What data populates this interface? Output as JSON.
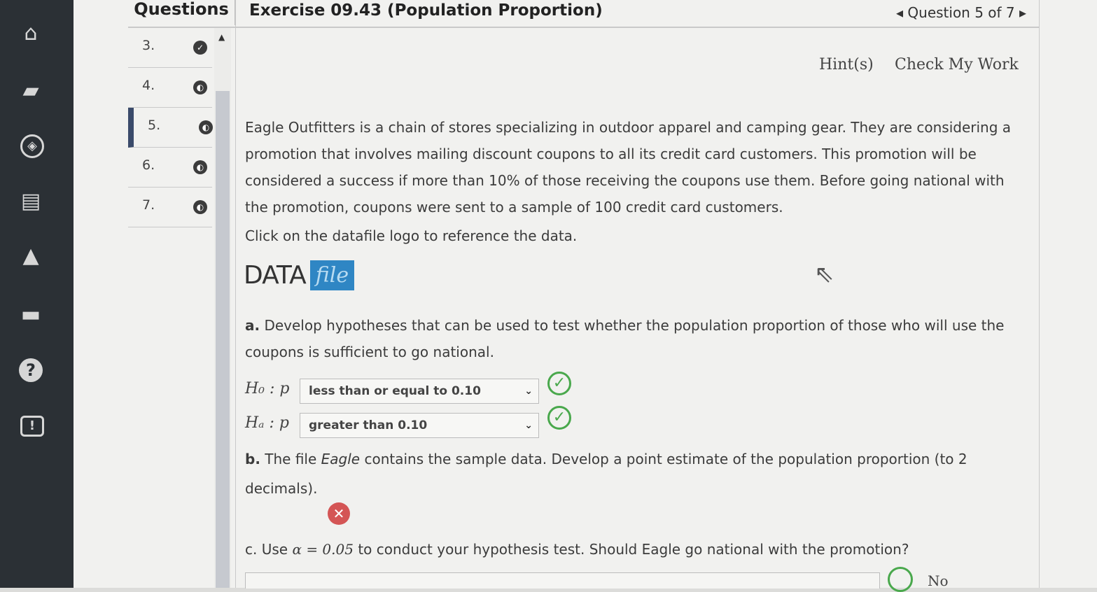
{
  "rail": {
    "icons": [
      "home-icon",
      "book-icon",
      "compass-icon",
      "reader-icon",
      "graduation-cap-icon",
      "briefcase-icon",
      "help-icon",
      "flag-icon"
    ]
  },
  "header": {
    "questions_label": "Questions",
    "title": "Exercise 09.43 (Population Proportion)",
    "nav_text": "◂ Question 5 of 7 ▸"
  },
  "questions": [
    {
      "num": "3.",
      "active": false
    },
    {
      "num": "4.",
      "active": false
    },
    {
      "num": "5.",
      "active": true
    },
    {
      "num": "6.",
      "active": false
    },
    {
      "num": "7.",
      "active": false
    }
  ],
  "actions": {
    "hint": "Hint(s)",
    "check": "Check My Work"
  },
  "problem": {
    "p1": "Eagle Outfitters is a chain of stores specializing in outdoor apparel and camping gear. They are considering a promotion that involves mailing discount coupons to all its credit card customers. This promotion will be considered a success if more than 10% of those receiving the coupons use them. Before going national with the promotion, coupons were sent to a sample of 100 credit card customers.",
    "click": "Click on the datafile logo to reference the data.",
    "logo_data": "DATA",
    "logo_file": "file"
  },
  "part_a": {
    "label": "a.",
    "text": "Develop hypotheses that can be used to test whether the population proportion of those who will use the coupons is sufficient to go national.",
    "h0_label": "H₀ : p",
    "h0_value": "less than or equal to 0.10",
    "ha_label": "Hₐ : p",
    "ha_value": "greater than 0.10"
  },
  "part_b": {
    "label": "b.",
    "text_before": "The file ",
    "file_name": "Eagle",
    "text_after": " contains the sample data. Develop a point estimate of the population proportion (to 2 decimals)."
  },
  "part_c": {
    "label": "c.",
    "text_before": "Use ",
    "alpha": "α = 0.05",
    "text_after": " to conduct your hypothesis test. Should Eagle go national with the promotion?",
    "answer": "No"
  }
}
